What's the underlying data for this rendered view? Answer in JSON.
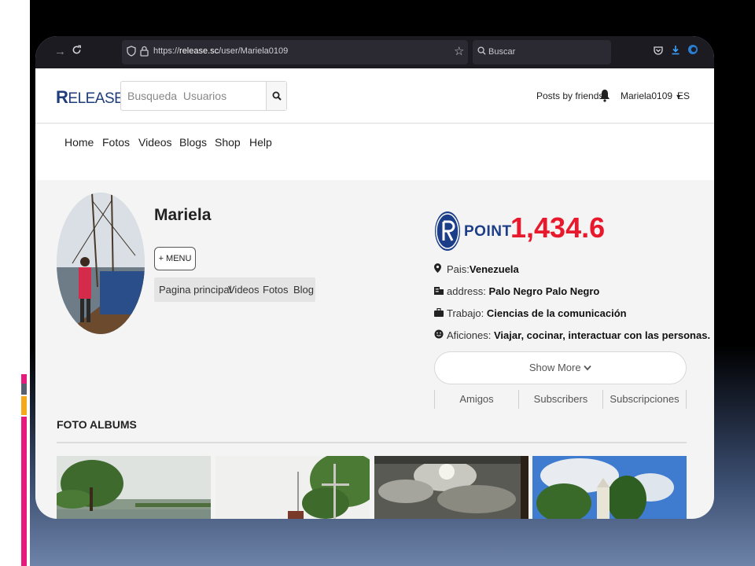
{
  "browser": {
    "url_prefix": "https://",
    "url_domain": "release.sc",
    "url_path": "/user/Mariela0109",
    "search_placeholder": "Buscar"
  },
  "site": {
    "logo_r": "R",
    "logo_rest": "ELEASE",
    "search_placeholder": "Busqueda  Usuarios",
    "posts_by_friends": "Posts by friends",
    "username": "Mariela0109",
    "language": "ES"
  },
  "nav": {
    "items": [
      "Home",
      "Fotos",
      "Videos",
      "Blogs",
      "Shop",
      "Help"
    ]
  },
  "profile": {
    "name": "Mariela",
    "menu_button": "+ MENU",
    "tabs": [
      "Pagina principal",
      "Videos",
      "Fotos",
      "Blog"
    ]
  },
  "rpoint": {
    "word": "POINT",
    "value": "1,434.6",
    "color": "#e8192c"
  },
  "info": {
    "pais_label": "Pais:",
    "pais_value": "Venezuela",
    "address_label": "address:",
    "address_value": "Palo Negro  Palo Negro",
    "trabajo_label": "Trabajo:",
    "trabajo_value": "Ciencias de la comunicación",
    "aficiones_label": "Aficiones:",
    "aficiones_value": "Viajar, cocinar, interactuar con las personas."
  },
  "show_more": "Show More",
  "social_tabs": [
    "Amigos",
    "Subscribers",
    "Subscripciones"
  ],
  "albums": {
    "title": "FOTO ALBUMS"
  },
  "colors": {
    "brand": "#1f3d7a",
    "accent_magenta": "#e6197d",
    "accent_yellow": "#f3a91a"
  }
}
